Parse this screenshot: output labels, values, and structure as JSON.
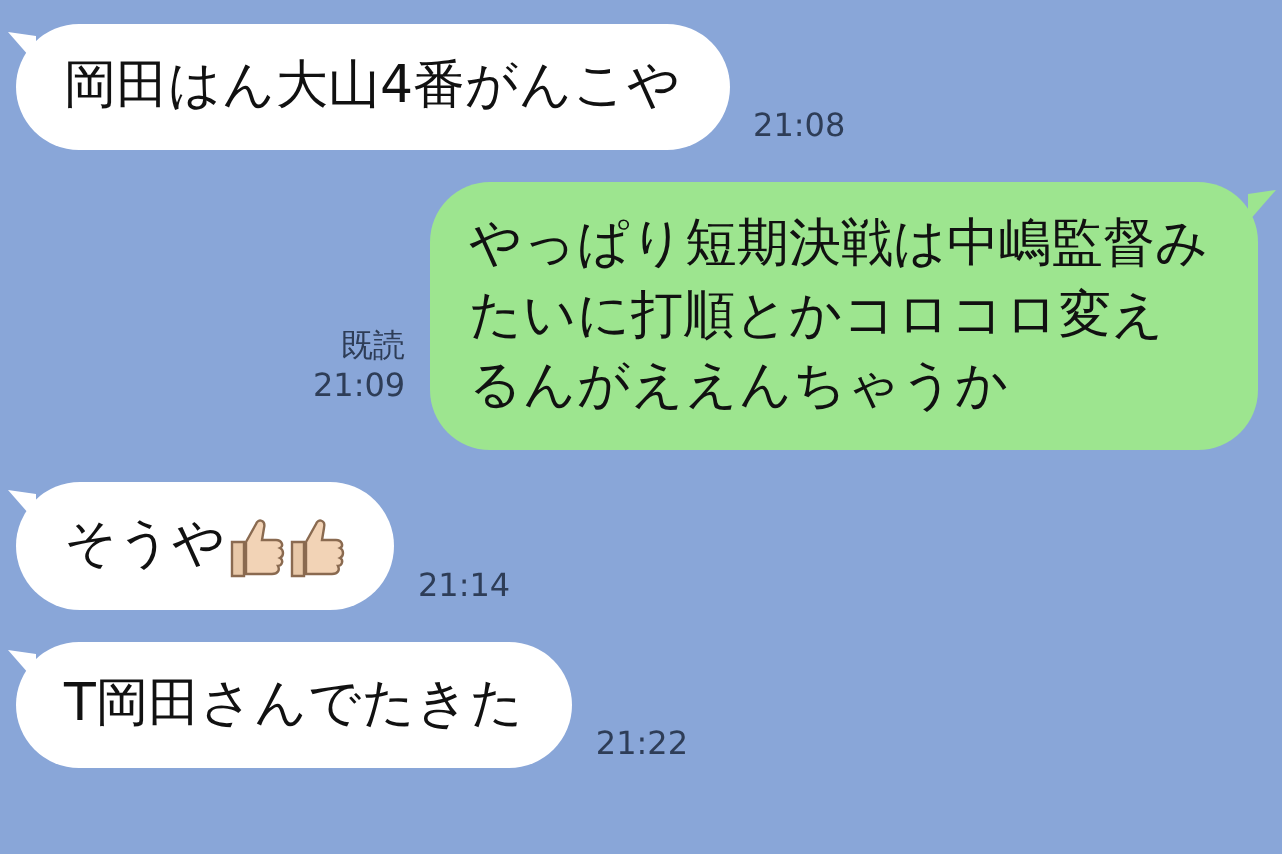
{
  "messages": [
    {
      "kind": "received",
      "parts": [
        {
          "kind": "text",
          "text": "岡田はん大山4番がんこや"
        }
      ],
      "time": "21:08"
    },
    {
      "kind": "sent",
      "parts": [
        {
          "kind": "text",
          "text": "やっぱり短期決戦は中嶋監督みたいに打順とかコロコロ変えるんがええんちゃうか"
        }
      ],
      "read": "既読",
      "time": "21:09"
    },
    {
      "kind": "received",
      "parts": [
        {
          "kind": "text",
          "text": "そうや"
        },
        {
          "kind": "thumbs-up"
        },
        {
          "kind": "thumbs-up"
        }
      ],
      "time": "21:14"
    },
    {
      "kind": "received",
      "parts": [
        {
          "kind": "text",
          "text": "T岡田さんでたきた"
        }
      ],
      "time": "21:22"
    }
  ]
}
